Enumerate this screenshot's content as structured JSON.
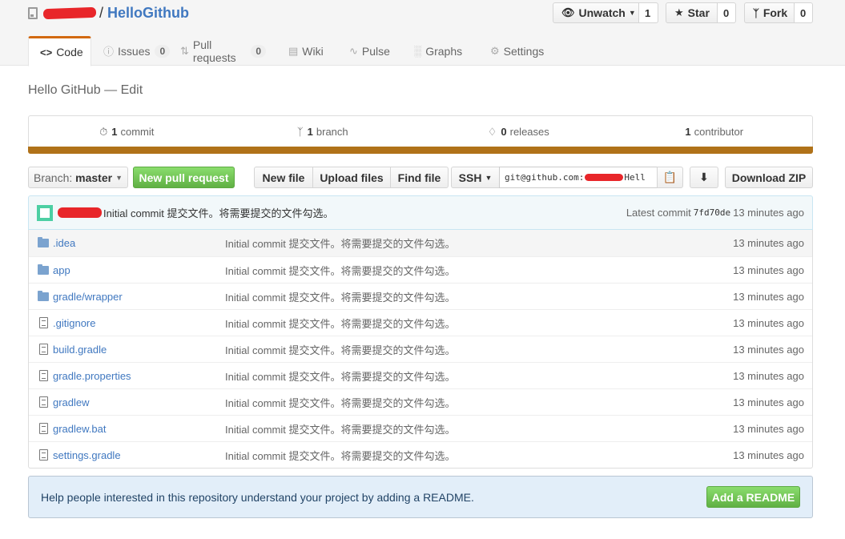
{
  "repo": {
    "name": "HelloGithub",
    "separator": "/",
    "description": "Hello GitHub — Edit"
  },
  "actions": {
    "watch": {
      "label": "Unwatch",
      "count": "1"
    },
    "star": {
      "label": "Star",
      "count": "0"
    },
    "fork": {
      "label": "Fork",
      "count": "0"
    }
  },
  "tabs": [
    {
      "label": "Code",
      "icon": "code-icon",
      "selected": true
    },
    {
      "label": "Issues",
      "icon": "issue-icon",
      "counter": "0"
    },
    {
      "label": "Pull requests",
      "icon": "pull-request-icon",
      "counter": "0"
    },
    {
      "label": "Wiki",
      "icon": "book-icon"
    },
    {
      "label": "Pulse",
      "icon": "pulse-icon"
    },
    {
      "label": "Graphs",
      "icon": "graph-icon"
    },
    {
      "label": "Settings",
      "icon": "gear-icon"
    }
  ],
  "summary": {
    "commits": {
      "count": "1",
      "label": "commit"
    },
    "branches": {
      "count": "1",
      "label": "branch"
    },
    "releases": {
      "count": "0",
      "label": "releases"
    },
    "contributors": {
      "count": "1",
      "label": "contributor"
    },
    "language_color": "#b07219"
  },
  "file_nav": {
    "branch_prefix": "Branch:",
    "branch_name": "master",
    "new_pull_request": "New pull request",
    "new_file": "New file",
    "upload_files": "Upload files",
    "find_file": "Find file",
    "protocol": "SSH",
    "clone_prefix": "git@github.com:",
    "clone_suffix": "Hell",
    "download_zip": "Download ZIP"
  },
  "latest_commit": {
    "message": "Initial commit 提交文件。将需要提交的文件勾选。",
    "label": "Latest commit",
    "sha": "7fd70de",
    "age": "13 minutes ago"
  },
  "files": [
    {
      "name": ".idea",
      "type": "folder",
      "message": "Initial commit 提交文件。将需要提交的文件勾选。",
      "age": "13 minutes ago"
    },
    {
      "name": "app",
      "type": "folder",
      "message": "Initial commit 提交文件。将需要提交的文件勾选。",
      "age": "13 minutes ago"
    },
    {
      "name": "gradle/wrapper",
      "type": "folder",
      "message": "Initial commit 提交文件。将需要提交的文件勾选。",
      "age": "13 minutes ago"
    },
    {
      "name": ".gitignore",
      "type": "file",
      "message": "Initial commit 提交文件。将需要提交的文件勾选。",
      "age": "13 minutes ago"
    },
    {
      "name": "build.gradle",
      "type": "file",
      "message": "Initial commit 提交文件。将需要提交的文件勾选。",
      "age": "13 minutes ago"
    },
    {
      "name": "gradle.properties",
      "type": "file",
      "message": "Initial commit 提交文件。将需要提交的文件勾选。",
      "age": "13 minutes ago"
    },
    {
      "name": "gradlew",
      "type": "file",
      "message": "Initial commit 提交文件。将需要提交的文件勾选。",
      "age": "13 minutes ago"
    },
    {
      "name": "gradlew.bat",
      "type": "file",
      "message": "Initial commit 提交文件。将需要提交的文件勾选。",
      "age": "13 minutes ago"
    },
    {
      "name": "settings.gradle",
      "type": "file",
      "message": "Initial commit 提交文件。将需要提交的文件勾选。",
      "age": "13 minutes ago"
    }
  ],
  "readme_prompt": {
    "text": "Help people interested in this repository understand your project by adding a README.",
    "button": "Add a README"
  }
}
